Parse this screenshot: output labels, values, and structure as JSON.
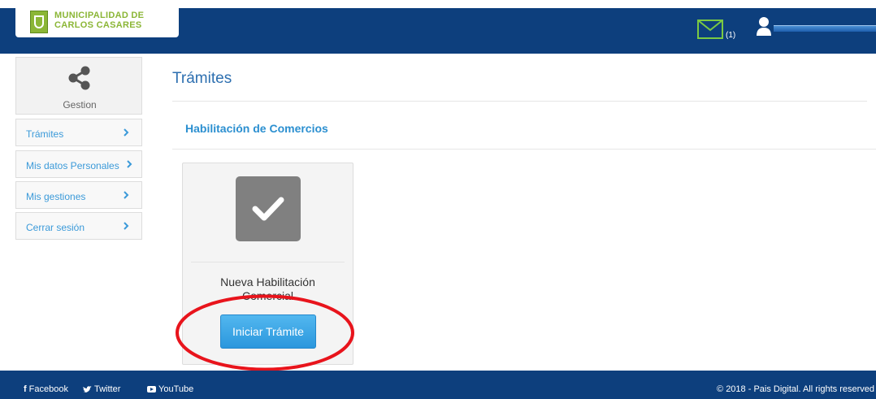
{
  "header": {
    "municipality_line1": "MUNICIPALIDAD DE",
    "municipality_line2": "CARLOS CASARES",
    "mail_count": "(1)",
    "icons": [
      "seal-icon",
      "envelope-icon",
      "user-icon"
    ]
  },
  "sidebar": {
    "head_label": "Gestion",
    "head_icon": "share-icon",
    "items": [
      {
        "label": "Trámites"
      },
      {
        "label": "Mis datos Personales"
      },
      {
        "label": "Mis gestiones"
      },
      {
        "label": "Cerrar sesión"
      }
    ]
  },
  "main": {
    "title": "Trámites",
    "section_title": "Habilitación de Comercios",
    "card": {
      "icon": "checkmark-icon",
      "title": "Nueva Habilitación Comercial",
      "button_label": "Iniciar Trámite"
    }
  },
  "footer": {
    "links": [
      {
        "icon": "f",
        "label": "Facebook"
      },
      {
        "icon": "twitter-bird-icon",
        "label": "Twitter"
      },
      {
        "icon": "youtube-icon",
        "label": "YouTube"
      }
    ],
    "copyright": "© 2018 - Pais Digital. All rights reserved"
  },
  "colors": {
    "header_bg": "#0d3f7d",
    "brand_green": "#8bb636",
    "link_blue": "#3b9ad9",
    "button_blue": "#2b97dd",
    "annotation_red": "#e8141c"
  }
}
